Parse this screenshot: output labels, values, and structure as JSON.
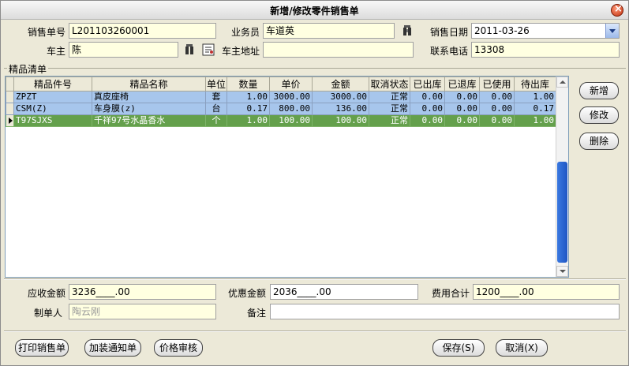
{
  "window": {
    "title": "新增/修改零件销售单"
  },
  "header": {
    "sale_no_label": "销售单号",
    "sale_no": "L201103260001",
    "salesman_label": "业务员",
    "salesman": "车道英",
    "sale_date_label": "销售日期",
    "sale_date": "2011-03-26",
    "owner_label": "车主",
    "owner": "陈",
    "owner_address_label": "车主地址",
    "owner_address": "",
    "phone_label": "联系电话",
    "phone": "13308"
  },
  "list": {
    "title": "精品清单",
    "columns": [
      "精品件号",
      "精品名称",
      "单位",
      "数量",
      "单价",
      "金额",
      "取消状态",
      "已出库",
      "已退库",
      "已使用",
      "待出库"
    ],
    "rows": [
      [
        "ZPZT",
        "真皮座椅",
        "套",
        "1.00",
        "3000.00",
        "3000.00",
        "正常",
        "0.00",
        "0.00",
        "0.00",
        "1.00"
      ],
      [
        "CSM(Z)",
        "车身膜(z)",
        "台",
        "0.17",
        "800.00",
        "136.00",
        "正常",
        "0.00",
        "0.00",
        "0.00",
        "0.17"
      ],
      [
        "T97SJXS",
        "千祥97号水晶香水",
        "个",
        "1.00",
        "100.00",
        "100.00",
        "正常",
        "0.00",
        "0.00",
        "0.00",
        "1.00"
      ]
    ]
  },
  "side_buttons": {
    "add": "新增",
    "edit": "修改",
    "delete": "删除"
  },
  "footer": {
    "receivable_label": "应收金额",
    "receivable": "3236____.00",
    "discount_label": "优惠金额",
    "discount": "2036____.00",
    "fee_total_label": "费用合计",
    "fee_total": "1200____.00",
    "creator_label": "制单人",
    "creator": "陶云刚",
    "remark_label": "备注",
    "remark": ""
  },
  "bottom_buttons": {
    "print": "打印销售单",
    "install_notice": "加装通知单",
    "price_audit": "价格审核",
    "save": "保存(S)",
    "cancel": "取消(X)"
  },
  "colors": {
    "field_bg": "#ffffe1",
    "selected_row": "#a7c6ec",
    "current_row": "#64a04c"
  }
}
